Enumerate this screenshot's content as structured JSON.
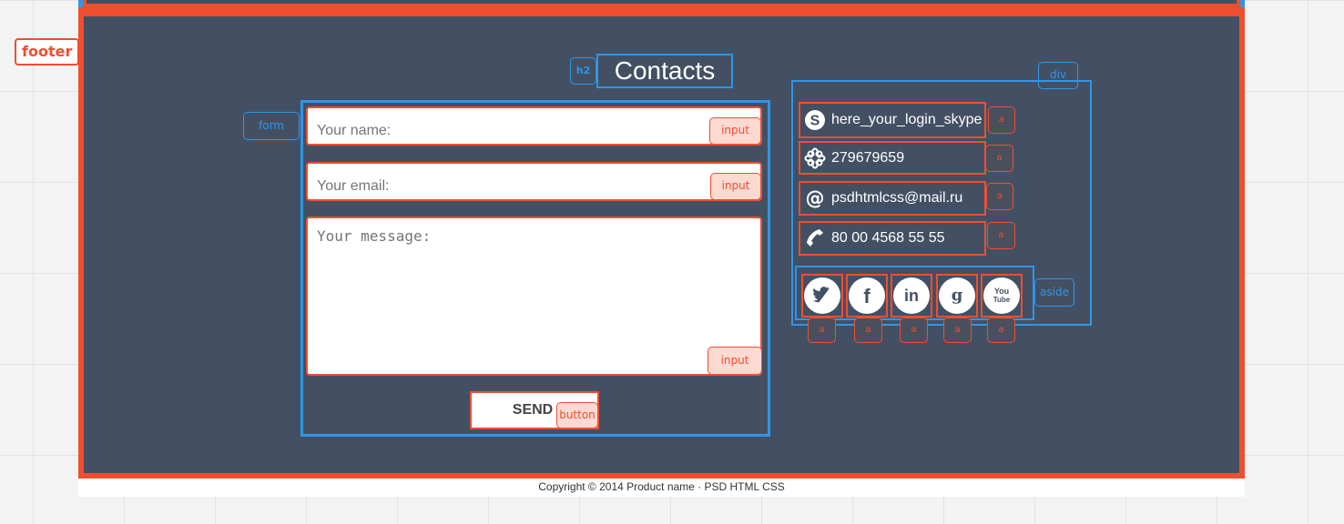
{
  "footer_label": "footer",
  "tags": {
    "h2": "h2",
    "form": "form",
    "input": "input",
    "button": "button",
    "div": "div",
    "aside": "aside",
    "a": "a"
  },
  "contacts_title": "Contacts",
  "form": {
    "name_placeholder": "Your name:",
    "email_placeholder": "Your email:",
    "message_placeholder": "Your message:",
    "send_label": "SEND"
  },
  "contacts": [
    {
      "icon": "skype-icon",
      "text": "here_your_login_skype"
    },
    {
      "icon": "icq-flower-icon",
      "text": "279679659"
    },
    {
      "icon": "at-sign-icon",
      "text": "psdhtmlcss@mail.ru"
    },
    {
      "icon": "phone-icon",
      "text": "80 00 4568 55 55"
    }
  ],
  "social": [
    "twitter-icon",
    "facebook-icon",
    "linkedin-icon",
    "google-icon",
    "youtube-icon"
  ],
  "youtube_text": {
    "line1": "You",
    "line2": "Tube"
  },
  "copyright": "Copyright © 2014 Product name · PSD HTML CSS",
  "colors": {
    "footer_bg": "#435063",
    "outline_red": "#f04e30",
    "outline_blue": "#2f96e8"
  }
}
